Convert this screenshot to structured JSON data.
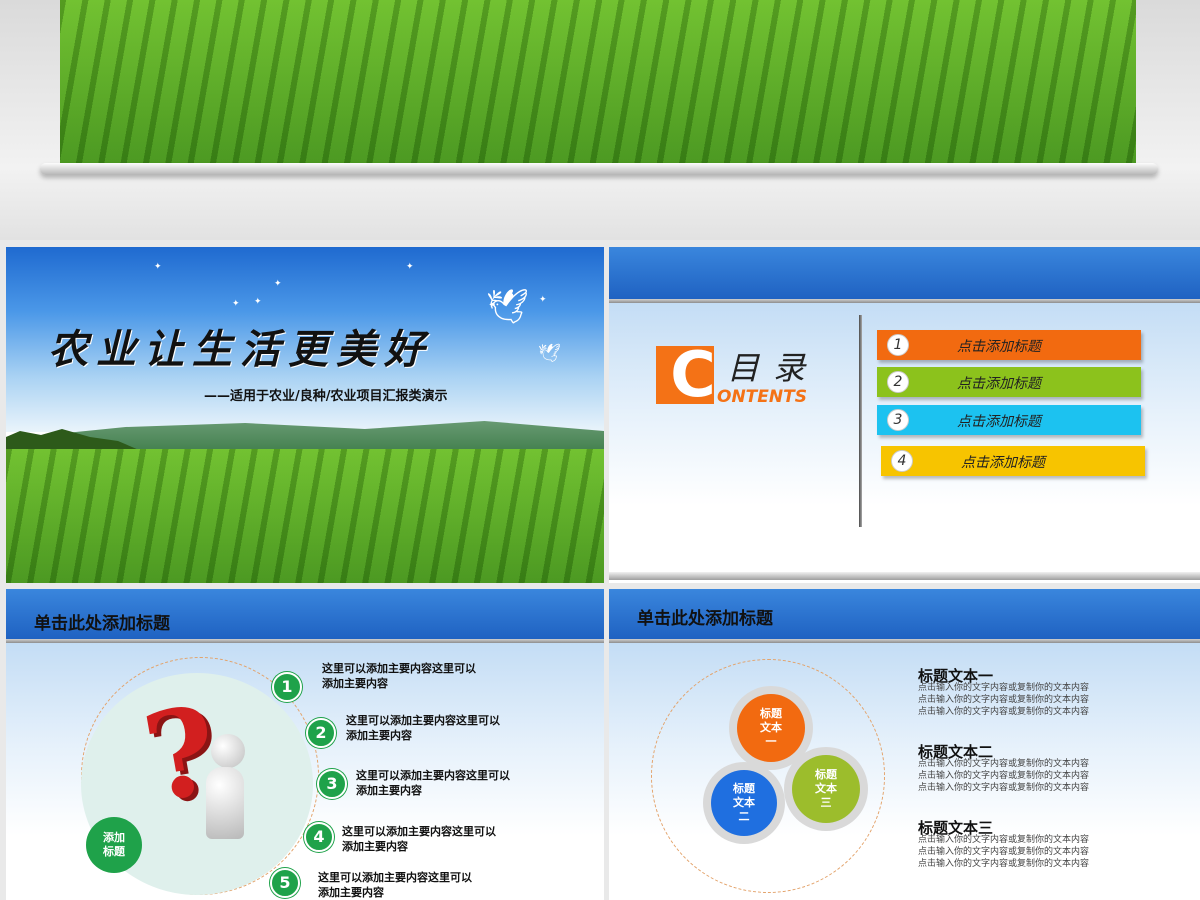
{
  "title_slide": {
    "title": "农业让生活更美好",
    "subtitle": "——适用于农业/良种/农业项目汇报类演示"
  },
  "contents_slide": {
    "c_letter": "C",
    "title": "目录",
    "subtitle": "ONTENTS",
    "items": [
      {
        "num": "1",
        "label": "点击添加标题",
        "color": "#f26a10"
      },
      {
        "num": "2",
        "label": "点击添加标题",
        "color": "#8cc21c"
      },
      {
        "num": "3",
        "label": "点击添加标题",
        "color": "#1cc2f0"
      },
      {
        "num": "4",
        "label": "点击添加标题",
        "color": "#f7c400"
      }
    ]
  },
  "questions_slide": {
    "title": "单击此处添加标题",
    "add_label": "添加\n标题",
    "items": [
      {
        "num": "1",
        "text": "这里可以添加主要内容这里可以\n添加主要内容"
      },
      {
        "num": "2",
        "text": "这里可以添加主要内容这里可以\n添加主要内容"
      },
      {
        "num": "3",
        "text": "这里可以添加主要内容这里可以\n添加主要内容"
      },
      {
        "num": "4",
        "text": "这里可以添加主要内容这里可以\n添加主要内容"
      },
      {
        "num": "5",
        "text": "这里可以添加主要内容这里可以\n添加主要内容"
      }
    ]
  },
  "venn_slide": {
    "title": "单击此处添加标题",
    "balls": [
      {
        "text": "标题\n文本\n一",
        "color": "#f26a10"
      },
      {
        "text": "标题\n文本\n二",
        "color": "#1f6fe0"
      },
      {
        "text": "标题\n文本\n三",
        "color": "#9cbd2c"
      }
    ],
    "blocks": [
      {
        "heading": "标题文本一",
        "desc": "点击输入你的文字内容或复制你的文本内容\n点击输入你的文字内容或复制你的文本内容\n点击输入你的文字内容或复制你的文本内容"
      },
      {
        "heading": "标题文本二",
        "desc": "点击输入你的文字内容或复制你的文本内容\n点击输入你的文字内容或复制你的文本内容\n点击输入你的文字内容或复制你的文本内容"
      },
      {
        "heading": "标题文本三",
        "desc": "点击输入你的文字内容或复制你的文本内容\n点击输入你的文字内容或复制你的文本内容\n点击输入你的文字内容或复制你的文本内容"
      }
    ]
  }
}
